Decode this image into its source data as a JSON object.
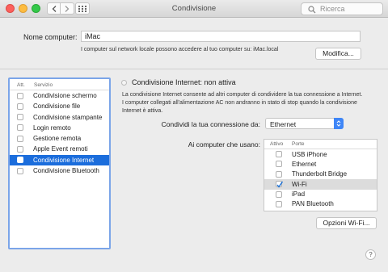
{
  "window": {
    "title": "Condivisione"
  },
  "toolbar": {
    "back_icon": "chevron-left-icon",
    "forward_icon": "chevron-right-icon",
    "grid_icon": "grid-icon",
    "search_placeholder": "Ricerca"
  },
  "computer_name": {
    "label": "Nome computer:",
    "value": "iMac",
    "help": "I computer sul network locale possono accedere al tuo computer su: iMac.local",
    "modify_button": "Modifica..."
  },
  "services": {
    "header_att": "Att.",
    "header_service": "Servizio",
    "items": [
      {
        "label": "Condivisione schermo",
        "checked": false,
        "selected": false
      },
      {
        "label": "Condivisione file",
        "checked": false,
        "selected": false
      },
      {
        "label": "Condivisione stampante",
        "checked": false,
        "selected": false
      },
      {
        "label": "Login remoto",
        "checked": false,
        "selected": false
      },
      {
        "label": "Gestione remota",
        "checked": false,
        "selected": false
      },
      {
        "label": "Apple Event remoti",
        "checked": false,
        "selected": false
      },
      {
        "label": "Condivisione Internet",
        "checked": false,
        "selected": true
      },
      {
        "label": "Condivisione Bluetooth",
        "checked": false,
        "selected": false
      }
    ]
  },
  "detail": {
    "status_title": "Condivisione Internet: non attiva",
    "description": "La condivisione Internet consente ad altri computer di condividere la tua connessione a Internet. I computer collegati all'alimentazione AC non andranno in stato di stop quando la condivisione Internet è attiva.",
    "share_label": "Condividi la tua connessione da:",
    "share_value": "Ethernet",
    "computers_label": "Ai computer che usano:",
    "ports_header_active": "Attivo",
    "ports_header_ports": "Porte",
    "ports": [
      {
        "label": "USB iPhone",
        "checked": false
      },
      {
        "label": "Ethernet",
        "checked": false
      },
      {
        "label": "Thunderbolt Bridge",
        "checked": false
      },
      {
        "label": "Wi-Fi",
        "checked": true
      },
      {
        "label": "iPad",
        "checked": false
      },
      {
        "label": "PAN Bluetooth",
        "checked": false
      }
    ],
    "wifi_options_button": "Opzioni Wi-Fi...",
    "help_button": "?"
  }
}
